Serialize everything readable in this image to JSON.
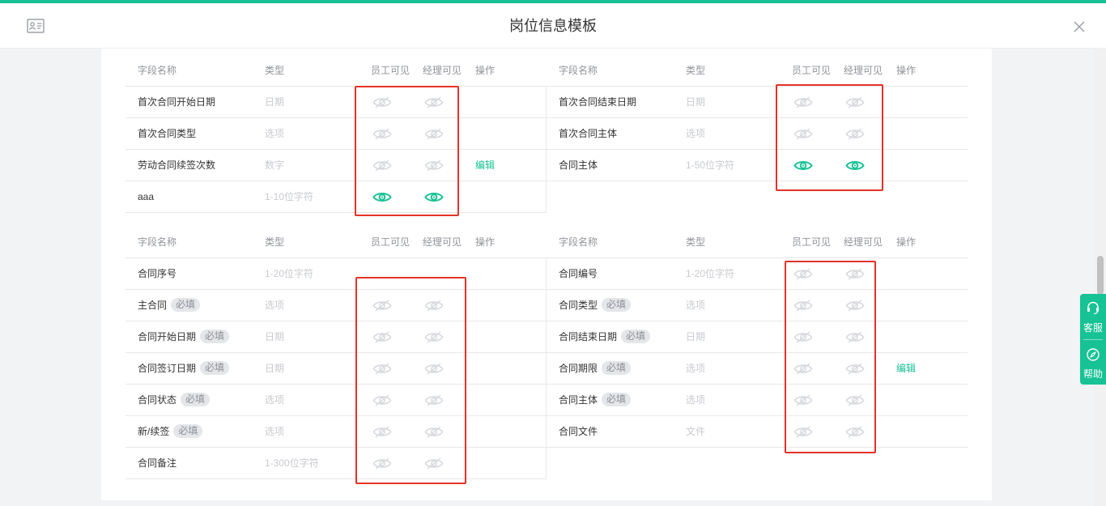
{
  "header": {
    "title": "岗位信息模板"
  },
  "icons": {
    "card": "contact-card-icon",
    "close": "close-icon",
    "eye_on": "eye-icon",
    "eye_off": "eye-off-icon",
    "headset": "headset-icon",
    "compass": "compass-icon"
  },
  "colors": {
    "accent": "#17c295",
    "highlight": "#e53228",
    "eye_off": "#d6d8dc"
  },
  "columns": {
    "name": "字段名称",
    "type": "类型",
    "employee": "员工可见",
    "manager": "经理可见",
    "operation": "操作"
  },
  "required_label": "必填",
  "sections": [
    {
      "left": [
        {
          "name": "首次合同开始日期",
          "required": false,
          "type": "日期",
          "employee_visible": false,
          "manager_visible": false,
          "action": ""
        },
        {
          "name": "首次合同类型",
          "required": false,
          "type": "选项",
          "employee_visible": false,
          "manager_visible": false,
          "action": ""
        },
        {
          "name": "劳动合同续签次数",
          "required": false,
          "type": "数字",
          "employee_visible": false,
          "manager_visible": false,
          "action": "编辑"
        },
        {
          "name": "aaa",
          "required": false,
          "type": "1-10位字符",
          "employee_visible": true,
          "manager_visible": true,
          "action": ""
        }
      ],
      "right": [
        {
          "name": "首次合同结束日期",
          "required": false,
          "type": "日期",
          "employee_visible": false,
          "manager_visible": false,
          "action": ""
        },
        {
          "name": "首次合同主体",
          "required": false,
          "type": "选项",
          "employee_visible": false,
          "manager_visible": false,
          "action": ""
        },
        {
          "name": "合同主体",
          "required": false,
          "type": "1-50位字符",
          "employee_visible": true,
          "manager_visible": true,
          "action": ""
        }
      ]
    },
    {
      "left": [
        {
          "name": "合同序号",
          "required": false,
          "type": "1-20位字符",
          "employee_visible": null,
          "manager_visible": null,
          "action": ""
        },
        {
          "name": "主合同",
          "required": true,
          "type": "选项",
          "employee_visible": false,
          "manager_visible": false,
          "action": ""
        },
        {
          "name": "合同开始日期",
          "required": true,
          "type": "日期",
          "employee_visible": false,
          "manager_visible": false,
          "action": ""
        },
        {
          "name": "合同签订日期",
          "required": true,
          "type": "日期",
          "employee_visible": false,
          "manager_visible": false,
          "action": ""
        },
        {
          "name": "合同状态",
          "required": true,
          "type": "选项",
          "employee_visible": false,
          "manager_visible": false,
          "action": ""
        },
        {
          "name": "新/续签",
          "required": true,
          "type": "选项",
          "employee_visible": false,
          "manager_visible": false,
          "action": ""
        },
        {
          "name": "合同备注",
          "required": false,
          "type": "1-300位字符",
          "employee_visible": false,
          "manager_visible": false,
          "action": ""
        }
      ],
      "right": [
        {
          "name": "合同编号",
          "required": false,
          "type": "1-20位字符",
          "employee_visible": false,
          "manager_visible": false,
          "action": ""
        },
        {
          "name": "合同类型",
          "required": true,
          "type": "选项",
          "employee_visible": false,
          "manager_visible": false,
          "action": ""
        },
        {
          "name": "合同结束日期",
          "required": true,
          "type": "日期",
          "employee_visible": false,
          "manager_visible": false,
          "action": ""
        },
        {
          "name": "合同期限",
          "required": true,
          "type": "选项",
          "employee_visible": false,
          "manager_visible": false,
          "action": "编辑"
        },
        {
          "name": "合同主体",
          "required": true,
          "type": "选项",
          "employee_visible": false,
          "manager_visible": false,
          "action": ""
        },
        {
          "name": "合同文件",
          "required": false,
          "type": "文件",
          "employee_visible": false,
          "manager_visible": false,
          "action": ""
        }
      ]
    }
  ],
  "float": {
    "service_label": "客服",
    "help_label": "帮助"
  }
}
